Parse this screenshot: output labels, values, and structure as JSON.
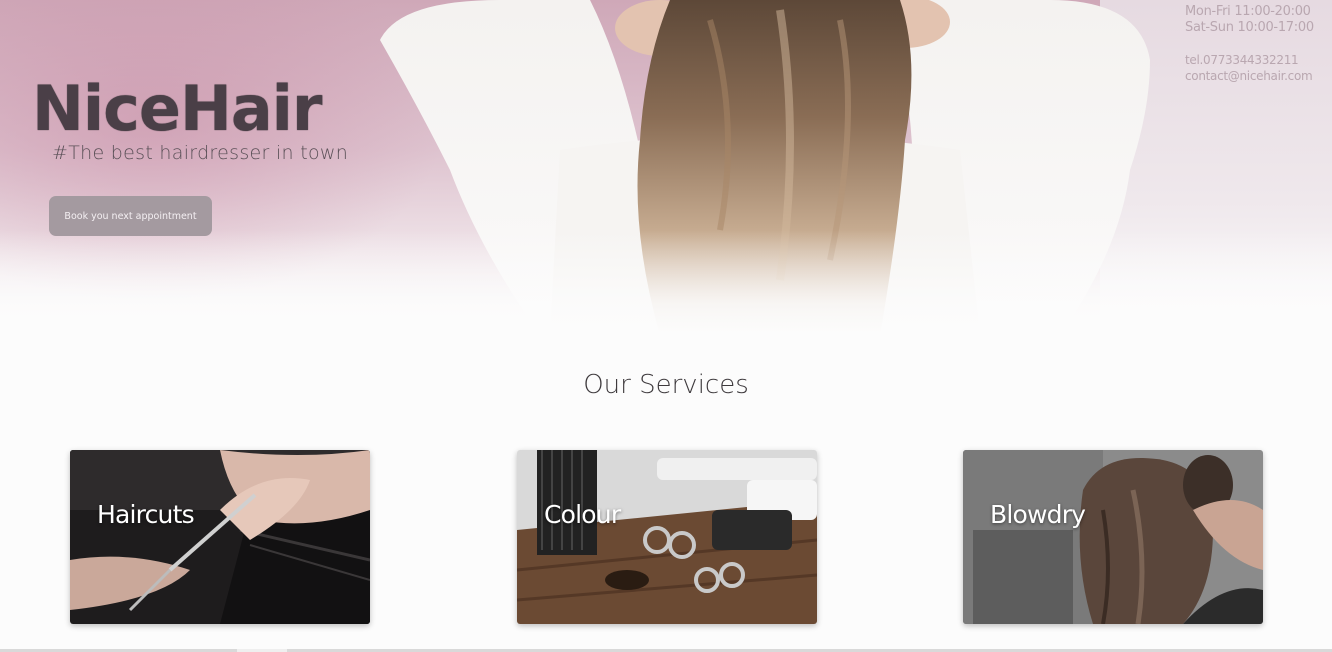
{
  "hero": {
    "brand": "NiceHair",
    "tagline": "#The best hairdresser in town",
    "book_button": "Book you next appointment"
  },
  "info": {
    "hours_weekday": "Mon-Fri 11:00-20:00",
    "hours_weekend": "Sat-Sun 10:00-17:00",
    "phone": "tel.0773344332211",
    "email": "contact@nicehair.com"
  },
  "services": {
    "title": "Our Services",
    "items": [
      {
        "label": "Haircuts"
      },
      {
        "label": "Colour"
      },
      {
        "label": "Blowdry"
      }
    ]
  },
  "colors": {
    "brand": "#4a3f47",
    "button": "#a49aa0",
    "hero_pink": "#cfa8b8"
  }
}
